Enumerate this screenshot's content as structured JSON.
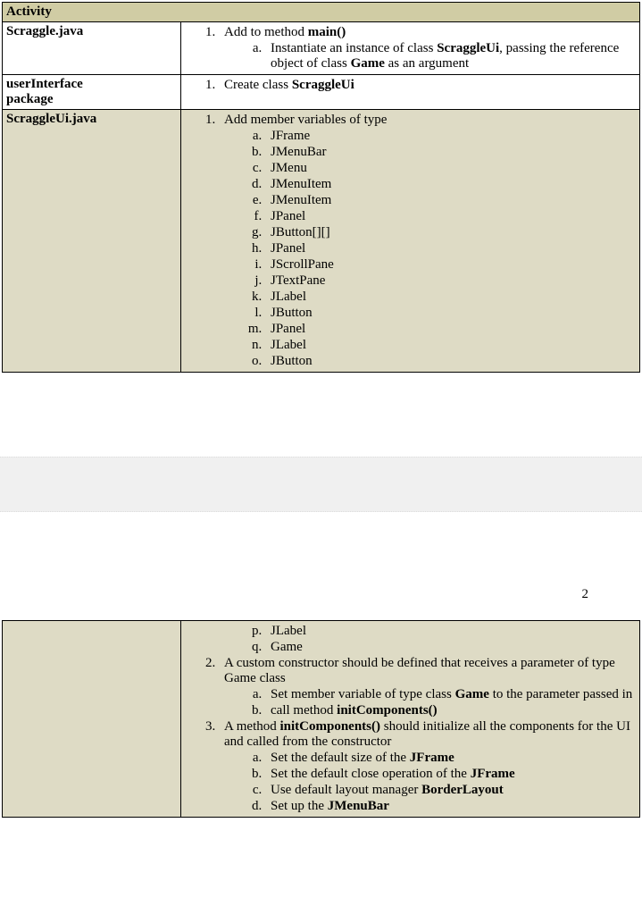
{
  "header": "Activity",
  "row1": {
    "col1": "Scraggle.java",
    "item1_prefix": "Add to method ",
    "item1_bold": "main()",
    "sub_a_prefix": "Instantiate an instance of class ",
    "sub_a_bold1": "ScraggleUi",
    "sub_a_mid": ", passing the reference object of class ",
    "sub_a_bold2": "Game",
    "sub_a_suffix": " as an argument"
  },
  "row2": {
    "col1_line1": "userInterface",
    "col1_line2": "package",
    "item1_prefix": "Create class ",
    "item1_bold": "ScraggleUi"
  },
  "row3": {
    "col1": "ScraggleUi.java",
    "item1": "Add member variables of type",
    "members": [
      "JFrame",
      "JMenuBar",
      "JMenu",
      "JMenuItem",
      "JMenuItem",
      "JPanel",
      "JButton[][]",
      "JPanel",
      "JScrollPane",
      "JTextPane",
      "JLabel",
      "JButton",
      "JPanel",
      "JLabel",
      "JButton"
    ]
  },
  "page_number": "2",
  "cont": {
    "members_cont": [
      "JLabel",
      "Game"
    ],
    "item2": "A custom constructor should be defined that receives a parameter of type Game class",
    "item2_a_prefix": "Set member variable of type class ",
    "item2_a_bold": "Game",
    "item2_a_suffix": " to the parameter passed in",
    "item2_b_prefix": "call method ",
    "item2_b_bold": "initComponents()",
    "item3_prefix": "A method ",
    "item3_bold": "initComponents()",
    "item3_suffix": " should initialize all the components for the UI and called from the constructor",
    "item3_a_prefix": "Set the default size of the ",
    "item3_a_bold": "JFrame",
    "item3_b_prefix": "Set the default close operation of the ",
    "item3_b_bold": "JFrame",
    "item3_c_prefix": "Use default layout manager ",
    "item3_c_bold": "BorderLayout",
    "item3_d_prefix": "Set up the ",
    "item3_d_bold": "JMenuBar"
  }
}
